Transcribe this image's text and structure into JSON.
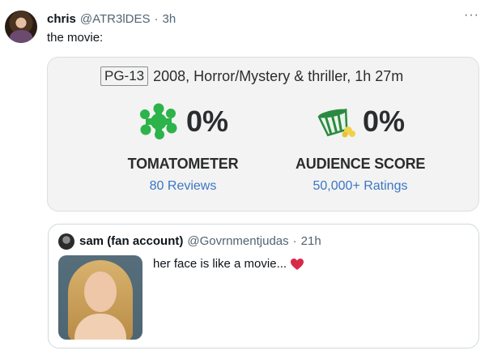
{
  "tweet": {
    "display_name": "chris",
    "handle": "@ATR3lDES",
    "separator": "·",
    "time": "3h",
    "more_label": "···",
    "text": "the movie:"
  },
  "rt_card": {
    "rating": "PG-13",
    "meta": "2008, Horror/Mystery & thriller, 1h 27m",
    "tomatometer": {
      "value": "0%",
      "label": "TOMATOMETER",
      "sub": "80 Reviews",
      "icon": "splat-icon",
      "color": "#2cb34a"
    },
    "audience": {
      "value": "0%",
      "label": "AUDIENCE SCORE",
      "sub": "50,000+ Ratings",
      "icon": "spilled-popcorn-icon",
      "color": "#2cb34a"
    }
  },
  "quote": {
    "display_name": "sam (fan account)",
    "handle": "@Govrnmentjudas",
    "separator": "·",
    "time": "21h",
    "text": "her face is like a movie...",
    "emoji": "heart-icon"
  },
  "colors": {
    "link": "#3a76c4",
    "muted": "#536471",
    "heart": "#d8294b"
  }
}
